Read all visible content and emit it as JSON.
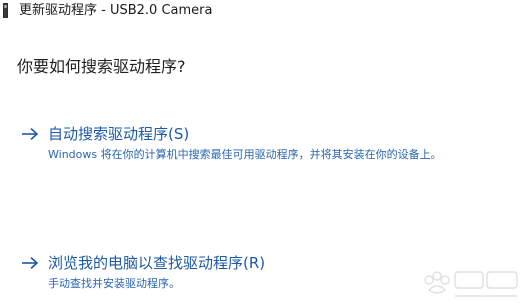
{
  "window": {
    "title": "更新驱动程序 - USB2.0 Camera",
    "title_icon": "usb-device-icon"
  },
  "main": {
    "heading": "你要如何搜索驱动程序?",
    "options": [
      {
        "icon": "arrow-right-icon",
        "label": "自动搜索驱动程序(S)",
        "description": "Windows 将在你的计算机中搜索最佳可用驱动程序，并将其安装在你的设备上。"
      },
      {
        "icon": "arrow-right-icon",
        "label": "浏览我的电脑以查找驱动程序(R)",
        "description": "手动查找并安装驱动程序。"
      }
    ]
  },
  "colors": {
    "link_blue": "#1d5aa6",
    "description_blue": "#2a65b3",
    "text_dark": "#1f1f1f"
  }
}
